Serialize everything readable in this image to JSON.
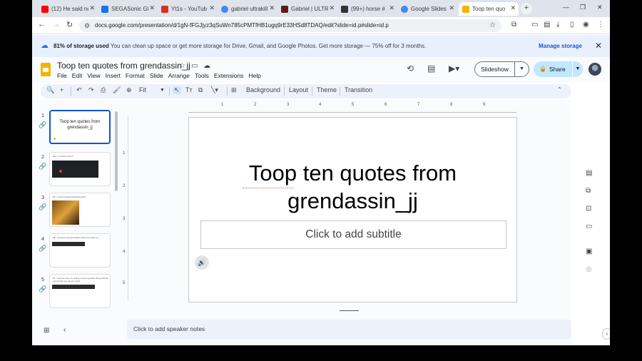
{
  "browser": {
    "tabs": [
      {
        "title": "(12) He said nc",
        "color": "#ff0000"
      },
      {
        "title": "SEGASonic GR",
        "color": "#1a73e8"
      },
      {
        "title": "Yt1s - YouTub",
        "color": "#d93025"
      },
      {
        "title": "gabriel ultrakill",
        "color": "#4285f4"
      },
      {
        "title": "Gabriel | ULTRA",
        "color": "#5f1a1a"
      },
      {
        "title": "(99+) horse #",
        "color": "#333333"
      },
      {
        "title": "Google Slides",
        "color": "#4285f4"
      },
      {
        "title": "Toop ten quo",
        "color": "#f4b400"
      }
    ],
    "url": "docs.google.com/presentation/d/1gN-fFGJjyz3qSuWn785cPMTfHB1ugq9rE33HSd8TDAQ/edit?slide=id.p#slide=id.p"
  },
  "banner": {
    "bold": "81% of storage used",
    "message": " You can clean up space or get more storage for Drive, Gmail, and Google Photos. Get more storage — 75% off for 3 months.",
    "manage": "Manage storage"
  },
  "doc": {
    "title": "Toop ten quotes from grendassin_jj",
    "menus": [
      "File",
      "Edit",
      "View",
      "Insert",
      "Format",
      "Slide",
      "Arrange",
      "Tools",
      "Extensions",
      "Help"
    ],
    "slideshow": "Slideshow",
    "share": "Share"
  },
  "toolbar": {
    "zoom": "Fit",
    "background": "Background",
    "layout": "Layout",
    "theme": "Theme",
    "transition": "Transition"
  },
  "filmstrip": {
    "slides": [
      {
        "num": "1",
        "text": "Toop ten quotes from grendassin_jj"
      },
      {
        "num": "2",
        "text": "#10: \"i'm bout to do it\""
      },
      {
        "num": "3",
        "text": "#9: \"my Doon Mode Deezbar plerc\""
      },
      {
        "num": "4",
        "text": "#8: \"someone find grendassin when he show up\""
      },
      {
        "num": "5",
        "text": "#7: \"Just me man, i'm doing a very important thing (school) you dumby see all you need\""
      }
    ]
  },
  "ruler": {
    "h": [
      "1",
      "2",
      "3",
      "4",
      "5",
      "6",
      "7",
      "8",
      "9"
    ],
    "v": [
      "1",
      "2",
      "3",
      "4",
      "5"
    ]
  },
  "slide": {
    "title": "Toop ten quotes from grendassin_jj",
    "subtitle_placeholder": "Click to add subtitle"
  },
  "notes": {
    "placeholder": "Click to add speaker notes"
  }
}
